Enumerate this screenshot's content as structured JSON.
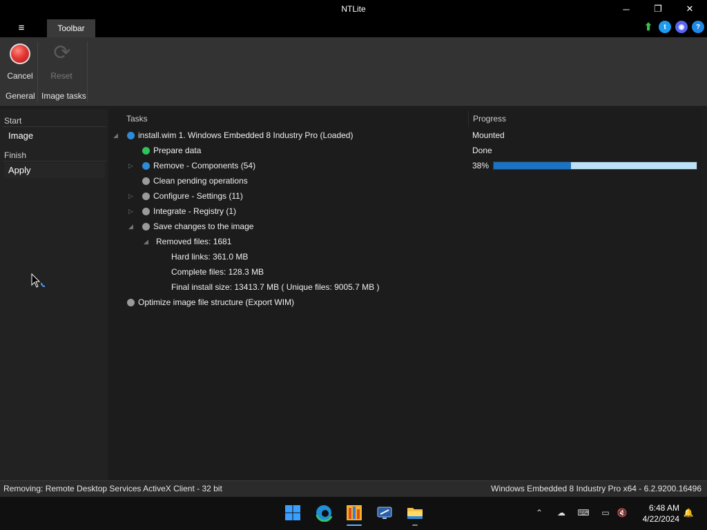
{
  "window": {
    "title": "NTLite",
    "controls": {
      "minimize": "─",
      "maximize": "❐",
      "close": "✕"
    }
  },
  "ribbon": {
    "menu_icon": "≡",
    "tab_label": "Toolbar",
    "social_icons": [
      "upload-arrow-icon",
      "twitter-icon",
      "discord-icon",
      "help-icon"
    ],
    "buttons": {
      "cancel": "Cancel",
      "reset": "Reset"
    },
    "groups": {
      "general": "General",
      "image_tasks": "Image tasks"
    }
  },
  "nav": {
    "sections": [
      {
        "label": "Start",
        "items": [
          "Image"
        ]
      },
      {
        "label": "Finish",
        "items": [
          "Apply"
        ]
      }
    ]
  },
  "tasks": {
    "headers": {
      "tasks": "Tasks",
      "progress": "Progress"
    },
    "rows": [
      {
        "label": "install.wim 1. Windows Embedded 8 Industry Pro  (Loaded)",
        "status": "Mounted",
        "dot": "blue",
        "level": 0
      },
      {
        "label": "Prepare data",
        "status": "Done",
        "dot": "green",
        "level": 1
      },
      {
        "label": "Remove - Components (54)",
        "status": "38%",
        "dot": "blue",
        "level": 1
      },
      {
        "label": "Clean pending operations",
        "dot": "gray",
        "level": 1
      },
      {
        "label": "Configure - Settings (11)",
        "dot": "gray",
        "level": 1
      },
      {
        "label": "Integrate - Registry (1)",
        "dot": "gray",
        "level": 1
      },
      {
        "label": "Save changes to the image",
        "dot": "gray",
        "level": 1
      },
      {
        "label": "Removed files: 1681",
        "level": 2
      },
      {
        "label": "Hard links: 361.0 MB",
        "level": 3
      },
      {
        "label": "Complete files: 128.3 MB",
        "level": 3
      },
      {
        "label": "Final install size: 13413.7 MB ( Unique files: 9005.7 MB )",
        "level": 3
      },
      {
        "label": "Optimize image file structure (Export WIM)",
        "dot": "gray",
        "level": 0
      }
    ],
    "progress_fraction": 0.38
  },
  "statusbar": {
    "left": "Removing: Remote Desktop Services ActiveX Client - 32 bit",
    "right": "Windows Embedded 8 Industry Pro x64 - 6.2.9200.16496"
  },
  "taskbar": {
    "apps": [
      "windows-start-icon",
      "edge-icon",
      "ntlite-icon",
      "remote-desktop-icon",
      "file-explorer-icon"
    ],
    "tray": [
      "chevron-up-icon",
      "network-off-icon",
      "keyboard-icon",
      "display-icon",
      "volume-muted-icon",
      "notification-bell-icon"
    ],
    "time": "6:48 AM",
    "date": "4/22/2024"
  },
  "colors": {
    "accent_blue": "#1a73c5",
    "progress_track": "#bde2f7",
    "done_green": "#2ec45a",
    "cancel_red": "#e53935"
  }
}
